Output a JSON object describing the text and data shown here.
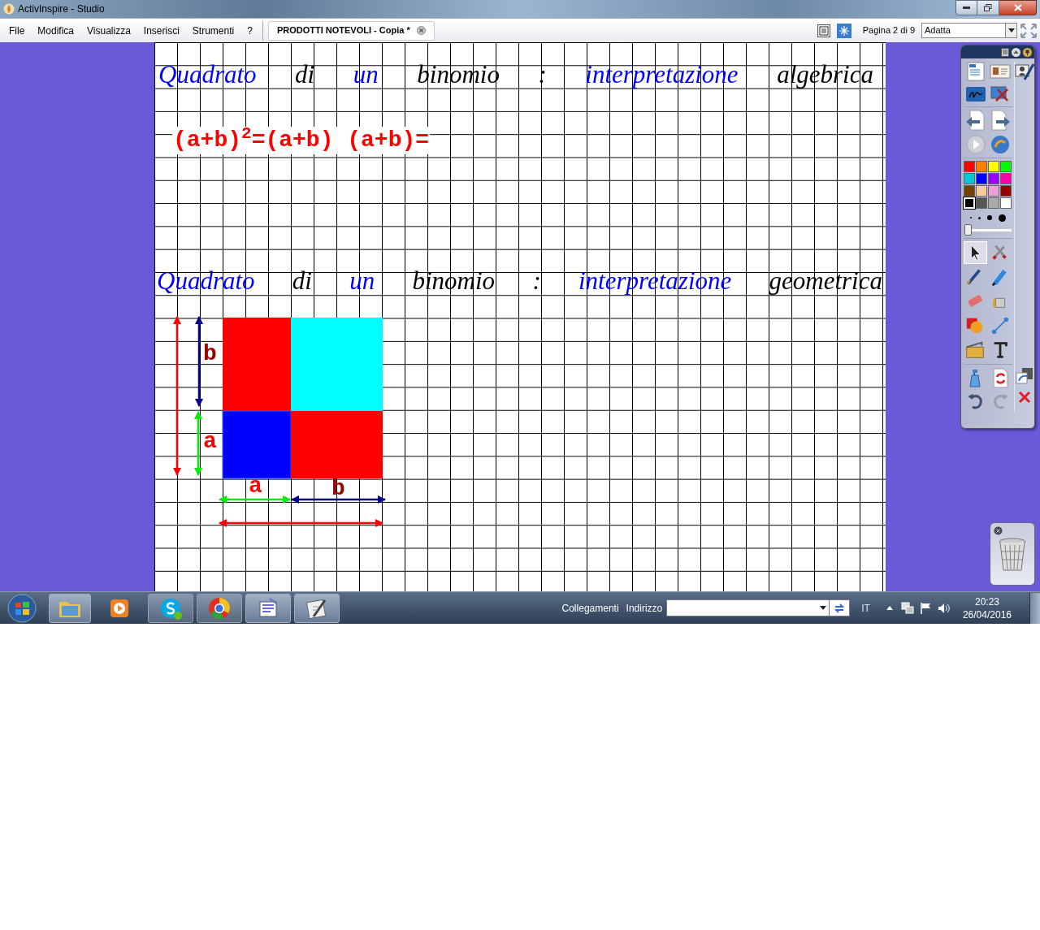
{
  "window": {
    "title": "ActivInspire - Studio"
  },
  "menu": [
    "File",
    "Modifica",
    "Visualizza",
    "Inserisci",
    "Strumenti",
    "?"
  ],
  "document_tab": {
    "label": "PRODOTTI NOTEVOLI - Copia *",
    "selected": true
  },
  "page_indicator": "Pagina 2 di 9",
  "zoom_select": {
    "value": "Adatta"
  },
  "page": {
    "heading_1": [
      {
        "text": "Quadrato",
        "color": "#0000ff"
      },
      {
        "text": "di",
        "color": "#000000"
      },
      {
        "text": "un",
        "color": "#0000ff"
      },
      {
        "text": "binomio",
        "color": "#000000"
      },
      {
        "text": ":",
        "color": "#000000"
      },
      {
        "text": "interpretazione",
        "color": "#0000ff"
      },
      {
        "text": "algebrica",
        "color": "#000000"
      }
    ],
    "formula": "(a+b)$^{2}$=(a+b) (a+b)=",
    "heading_2": [
      {
        "text": "Quadrato",
        "color": "#0000ff"
      },
      {
        "text": "di",
        "color": "#000000"
      },
      {
        "text": "un",
        "color": "#0000ff"
      },
      {
        "text": "binomio",
        "color": "#000000"
      },
      {
        "text": ":",
        "color": "#000000"
      },
      {
        "text": "interpretazione",
        "color": "#0000ff"
      },
      {
        "text": "geometrica",
        "color": "#000000"
      }
    ],
    "diagram_labels": [
      {
        "text": "b",
        "color": "#990000"
      },
      {
        "text": "a",
        "color": "#ff0000"
      },
      {
        "text": "a",
        "color": "#ff0000"
      },
      {
        "text": "b",
        "color": "#990000"
      }
    ]
  },
  "toolbox": {
    "palette": [
      {
        "color": "#ff0000",
        "selected": false
      },
      {
        "color": "#ff8000",
        "selected": false
      },
      {
        "color": "#ffff00",
        "selected": false
      },
      {
        "color": "#00ff00",
        "selected": false
      },
      {
        "color": "#00c8d8",
        "selected": false
      },
      {
        "color": "#0000ff",
        "selected": false
      },
      {
        "color": "#9900ff",
        "selected": false
      },
      {
        "color": "#ff00aa",
        "selected": false
      },
      {
        "color": "#7a3f00",
        "selected": false
      },
      {
        "color": "#f8cc9c",
        "selected": false
      },
      {
        "color": "#f0a0d8",
        "selected": false
      },
      {
        "color": "#990000",
        "selected": false
      },
      {
        "color": "#000000",
        "selected": true
      },
      {
        "color": "#555555",
        "selected": false
      },
      {
        "color": "#aaaaaa",
        "selected": false
      },
      {
        "color": "#ffffff",
        "selected": false
      }
    ],
    "pen_width": {
      "level": 0.0
    },
    "tools": [
      {
        "selected": true
      },
      {
        "selected": false
      },
      {
        "selected": false
      },
      {
        "selected": false
      },
      {
        "selected": false
      },
      {
        "selected": false
      },
      {
        "selected": false
      },
      {
        "selected": false
      },
      {
        "selected": false
      },
      {
        "selected": false
      }
    ]
  },
  "taskbar": {
    "links_label": "Collegamenti",
    "address_label": "Indirizzo",
    "language": "IT",
    "time": "20:23",
    "date": "26/04/2016"
  }
}
